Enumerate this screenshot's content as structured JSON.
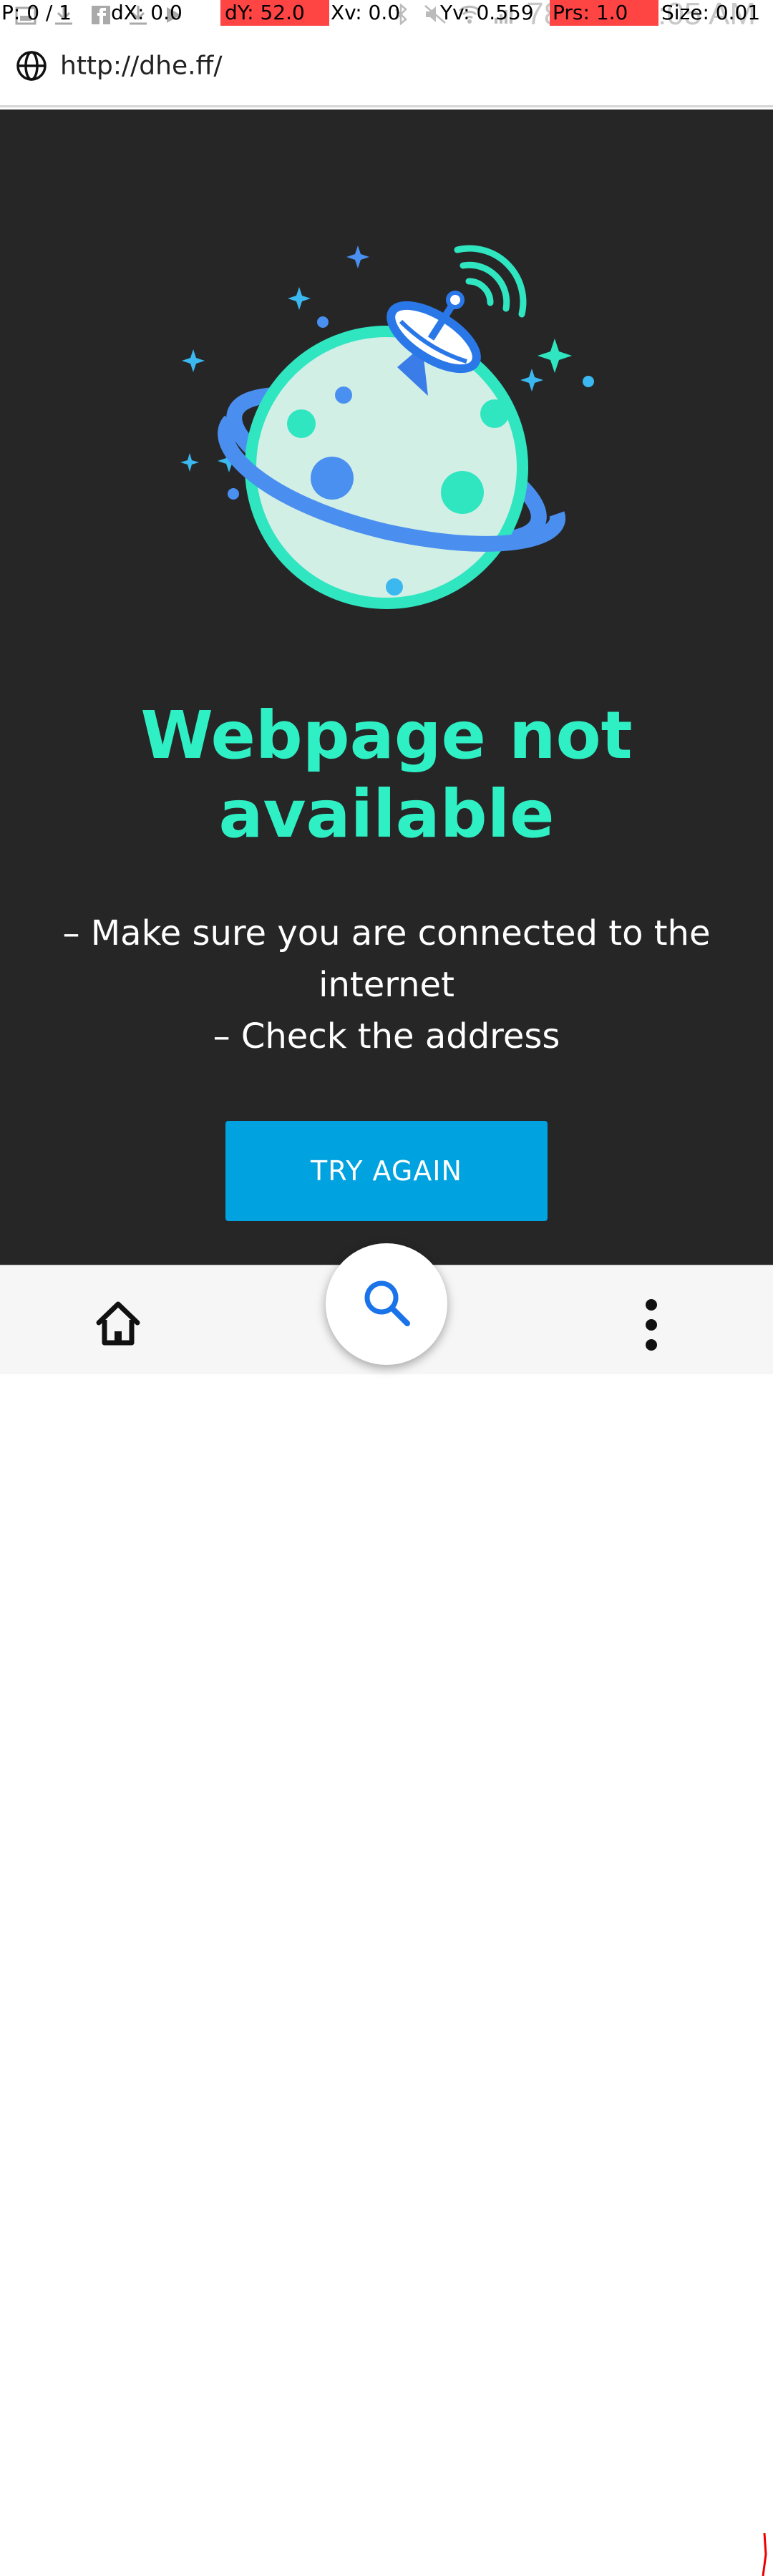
{
  "status_bar": {
    "battery": "78%",
    "time": "11:05 AM"
  },
  "debug_overlay": {
    "pointer": "P: 0 / 1",
    "dx": "dX: 0.0",
    "dy": "dY: 52.0",
    "xv": "Xv: 0.0",
    "yv": "Yv: 0.559",
    "prs": "Prs: 1.0",
    "size": "Size: 0.01"
  },
  "address_bar": {
    "url": "http://dhe.ff/"
  },
  "error_page": {
    "title_line1": "Webpage not",
    "title_line2": "available",
    "hint_line1": "– Make sure you are connected to the",
    "hint_line2": "internet",
    "hint_line3": "– Check the address",
    "button_label": "TRY AGAIN"
  },
  "colors": {
    "background": "#262627",
    "accent": "#2ff0c4",
    "button": "#00a2e0"
  },
  "icons": {
    "home": "home-icon",
    "search": "search-icon",
    "menu": "more-vert-icon",
    "globe": "globe-icon"
  }
}
